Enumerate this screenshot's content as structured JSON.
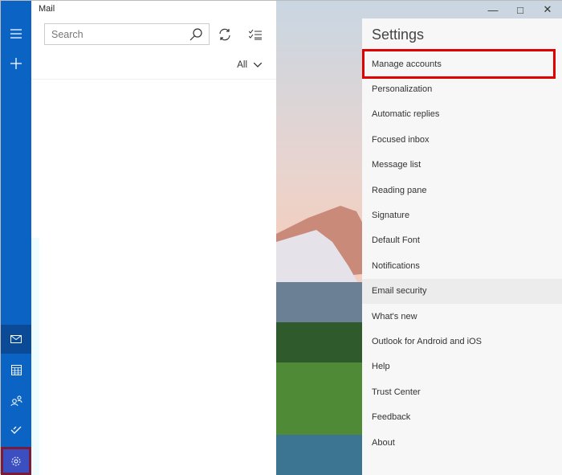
{
  "app": {
    "title": "Mail"
  },
  "search": {
    "placeholder": "Search"
  },
  "filter": {
    "label": "All"
  },
  "sidebar": [
    "hamburger-icon",
    "plus-icon",
    "mail-icon",
    "calendar-icon",
    "people-icon",
    "todo-icon",
    "settings-icon"
  ],
  "settings": {
    "title": "Settings",
    "items": [
      "Manage accounts",
      "Personalization",
      "Automatic replies",
      "Focused inbox",
      "Message list",
      "Reading pane",
      "Signature",
      "Default Font",
      "Notifications",
      "Email security",
      "What's new",
      "Outlook for Android and iOS",
      "Help",
      "Trust Center",
      "Feedback",
      "About"
    ]
  },
  "colors": {
    "sidebar": "#0b63c4",
    "highlight": "#e00000"
  }
}
